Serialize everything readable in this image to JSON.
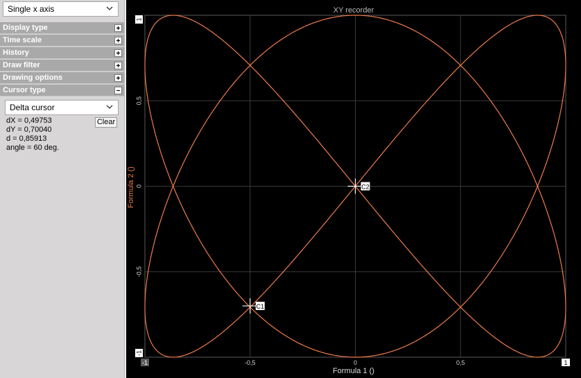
{
  "left_panel": {
    "axis_mode": "Single x axis",
    "sections": [
      {
        "label": "Display type",
        "state": "collapsed"
      },
      {
        "label": "Time scale",
        "state": "collapsed"
      },
      {
        "label": "History",
        "state": "collapsed"
      },
      {
        "label": "Draw filter",
        "state": "collapsed"
      },
      {
        "label": "Drawing options",
        "state": "collapsed"
      },
      {
        "label": "Cursor type",
        "state": "expanded"
      }
    ],
    "cursor_type": "Delta cursor",
    "clear_label": "Clear",
    "dx": "dX = 0,49753",
    "dy": "dY = 0,70040",
    "d": "d = 0,85913",
    "angle": "angle = 60 deg."
  },
  "chart_data": {
    "type": "line",
    "title": "XY recorder",
    "xlabel": "Formula 1 ()",
    "ylabel": "Formula 2 ()",
    "xlim": [
      -1,
      1
    ],
    "ylim": [
      -1,
      1
    ],
    "x_ticks": [
      "-1",
      "-0,5",
      "0",
      "0,5",
      "1"
    ],
    "y_ticks": [
      "1",
      "0,5",
      "0",
      "-0,5",
      "-1"
    ],
    "grid": true,
    "series": [
      {
        "curve": "lissajous",
        "x": "sin(2t)",
        "y": "cos(3t)",
        "color": "#f07c4a"
      }
    ],
    "cursors": [
      {
        "label": "C1",
        "x": -0.5,
        "y": -0.7
      },
      {
        "label": "C2",
        "x": 0.0,
        "y": 0.0
      }
    ],
    "colors": {
      "background": "#000000",
      "grid": "#3a3a3a",
      "curve": "#f07c4a",
      "panel": "#d8d6d6"
    }
  }
}
